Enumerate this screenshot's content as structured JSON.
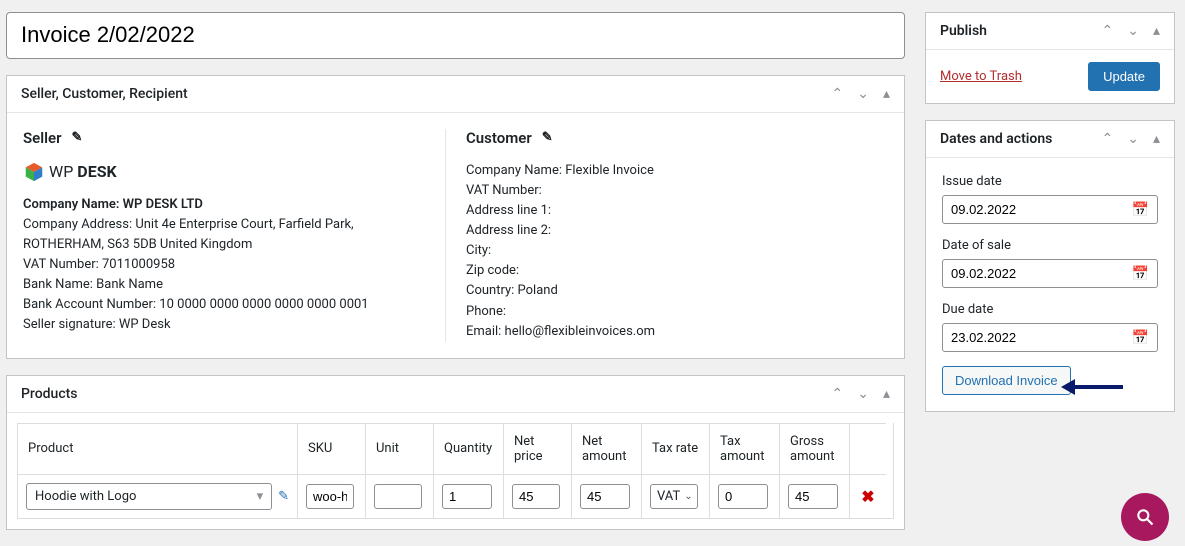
{
  "title": "Invoice 2/02/2022",
  "boxes": {
    "scr": {
      "title": "Seller, Customer, Recipient",
      "seller": {
        "heading": "Seller",
        "logoText": "WPDESK",
        "companyLabel": "Company Name:",
        "companyName": "WP DESK LTD",
        "address": "Company Address: Unit 4e Enterprise Court, Farfield Park, ROTHERHAM, S63 5DB United Kingdom",
        "vat": "VAT Number: 7011000958",
        "bankName": "Bank Name: Bank Name",
        "bankAccount": "Bank Account Number: 10 0000 0000 0000 0000 0000 0001",
        "signature": "Seller signature: WP Desk"
      },
      "customer": {
        "heading": "Customer",
        "companyName": "Company Name: Flexible Invoice",
        "vat": "VAT Number:",
        "addr1": "Address line 1:",
        "addr2": "Address line 2:",
        "city": "City:",
        "zip": "Zip code:",
        "country": "Country: Poland",
        "phone": "Phone:",
        "email": "Email: hello@flexibleinvoices.om"
      }
    },
    "products": {
      "title": "Products",
      "headers": {
        "product": "Product",
        "sku": "SKU",
        "unit": "Unit",
        "qty": "Quantity",
        "netPrice": "Net price",
        "netAmount": "Net amount",
        "taxRate": "Tax rate",
        "taxAmount": "Tax amount",
        "gross": "Gross amount"
      },
      "rows": [
        {
          "product": "Hoodie with Logo",
          "sku": "woo-hoodie",
          "unit": "",
          "qty": "1",
          "netPrice": "45",
          "netAmount": "45",
          "taxRate": "VAT",
          "taxAmount": "0",
          "gross": "45"
        }
      ]
    }
  },
  "sidebar": {
    "publish": {
      "title": "Publish",
      "trash": "Move to Trash",
      "update": "Update"
    },
    "dates": {
      "title": "Dates and actions",
      "issueLabel": "Issue date",
      "issueValue": "09.02.2022",
      "saleLabel": "Date of sale",
      "saleValue": "09.02.2022",
      "dueLabel": "Due date",
      "dueValue": "23.02.2022",
      "download": "Download Invoice"
    }
  }
}
